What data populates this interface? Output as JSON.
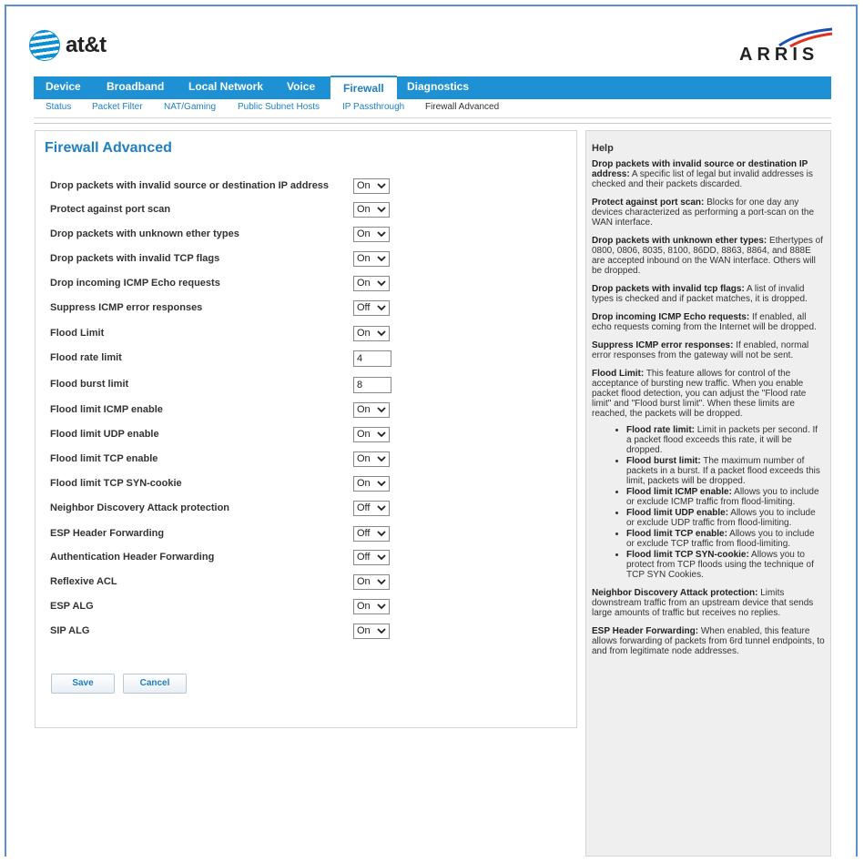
{
  "brand": {
    "att_label": "at&t",
    "arris_label": "ARRIS"
  },
  "nav": {
    "tabs": [
      "Device",
      "Broadband",
      "Local Network",
      "Voice",
      "Firewall",
      "Diagnostics"
    ],
    "active_tab": "Firewall",
    "subtabs": [
      "Status",
      "Packet Filter",
      "NAT/Gaming",
      "Public Subnet Hosts",
      "IP Passthrough",
      "Firewall Advanced"
    ],
    "active_subtab": "Firewall Advanced"
  },
  "page": {
    "title": "Firewall Advanced"
  },
  "settings": [
    {
      "label": "Drop packets with invalid source or destination IP address",
      "value": "On",
      "type": "select"
    },
    {
      "label": "Protect against port scan",
      "value": "On",
      "type": "select"
    },
    {
      "label": "Drop packets with unknown ether types",
      "value": "On",
      "type": "select"
    },
    {
      "label": "Drop packets with invalid TCP flags",
      "value": "On",
      "type": "select"
    },
    {
      "label": "Drop incoming ICMP Echo requests",
      "value": "On",
      "type": "select"
    },
    {
      "label": "Suppress ICMP error responses",
      "value": "Off",
      "type": "select"
    },
    {
      "label": "Flood Limit",
      "value": "On",
      "type": "select"
    },
    {
      "label": "Flood rate limit",
      "value": "4",
      "type": "text"
    },
    {
      "label": "Flood burst limit",
      "value": "8",
      "type": "text"
    },
    {
      "label": "Flood limit ICMP enable",
      "value": "On",
      "type": "select"
    },
    {
      "label": "Flood limit UDP enable",
      "value": "On",
      "type": "select"
    },
    {
      "label": "Flood limit TCP enable",
      "value": "On",
      "type": "select"
    },
    {
      "label": "Flood limit TCP SYN-cookie",
      "value": "On",
      "type": "select"
    },
    {
      "label": "Neighbor Discovery Attack protection",
      "value": "Off",
      "type": "select"
    },
    {
      "label": "ESP Header Forwarding",
      "value": "Off",
      "type": "select"
    },
    {
      "label": "Authentication Header Forwarding",
      "value": "Off",
      "type": "select"
    },
    {
      "label": "Reflexive ACL",
      "value": "On",
      "type": "select"
    },
    {
      "label": "ESP ALG",
      "value": "On",
      "type": "select"
    },
    {
      "label": "SIP ALG",
      "value": "On",
      "type": "select"
    }
  ],
  "buttons": {
    "save": "Save",
    "cancel": "Cancel"
  },
  "help": {
    "title": "Help",
    "sections": [
      {
        "term": "Drop packets with invalid source or destination IP address:",
        "text": " A specific list of legal but invalid addresses is checked and their packets discarded."
      },
      {
        "term": "Protect against port scan:",
        "text": " Blocks for one day any devices characterized as performing a port-scan on the WAN interface."
      },
      {
        "term": "Drop packets with unknown ether types:",
        "text": " Ethertypes of 0800, 0806, 8035, 8100, 86DD, 8863, 8864, and 888E are accepted inbound on the WAN interface. Others will be dropped."
      },
      {
        "term": "Drop packets with invalid tcp flags:",
        "text": " A list of invalid types is checked and if packet matches, it is dropped."
      },
      {
        "term": "Drop incoming ICMP Echo requests:",
        "text": " If enabled, all echo requests coming from the Internet will be dropped."
      },
      {
        "term": "Suppress ICMP error responses:",
        "text": " If enabled, normal error responses from the gateway will not be sent."
      },
      {
        "term": "Flood Limit:",
        "text": " This feature allows for control of the acceptance of bursting new traffic. When you enable packet flood detection, you can adjust the \"Flood rate limit\" and \"Flood burst limit\". When these limits are reached, the packets will be dropped."
      }
    ],
    "bullets": [
      {
        "term": "Flood rate limit:",
        "text": " Limit in packets per second. If a packet flood exceeds this rate, it will be dropped."
      },
      {
        "term": "Flood burst limit:",
        "text": " The maximum number of packets in a burst. If a packet flood exceeds this limit, packets will be dropped."
      },
      {
        "term": "Flood limit ICMP enable:",
        "text": " Allows you to include or exclude ICMP traffic from flood-limiting."
      },
      {
        "term": "Flood limit UDP enable:",
        "text": " Allows you to include or exclude UDP traffic from flood-limiting."
      },
      {
        "term": "Flood limit TCP enable:",
        "text": " Allows you to include or exclude TCP traffic from flood-limiting."
      },
      {
        "term": "Flood limit TCP SYN-cookie:",
        "text": " Allows you to protect from TCP floods using the technique of TCP SYN Cookies."
      }
    ],
    "after": [
      {
        "term": "Neighbor Discovery Attack protection:",
        "text": " Limits downstream traffic from an upstream device that sends large amounts of traffic but receives no replies."
      },
      {
        "term": "ESP Header Forwarding:",
        "text": " When enabled, this feature allows forwarding of packets from 6rd tunnel endpoints, to and from legitimate node addresses."
      }
    ]
  },
  "colors": {
    "nav_blue": "#1e90d4",
    "link_blue": "#1e7fc2",
    "help_bg": "#efefef"
  }
}
